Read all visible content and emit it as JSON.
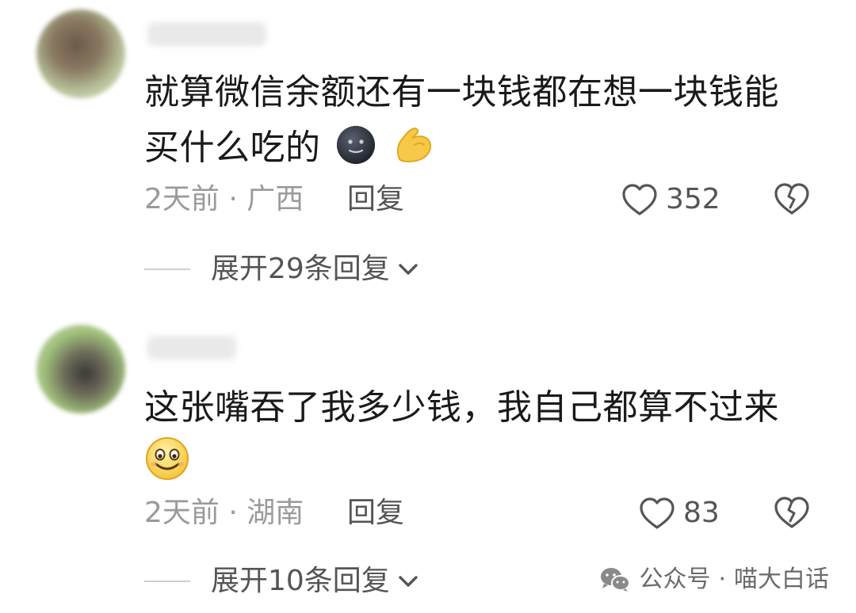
{
  "comments": [
    {
      "text_line1": "就算微信余额还有一块钱都在想一块钱能",
      "text_line2": "买什么吃的",
      "emojis": [
        "new-moon-face-icon",
        "flexed-biceps-icon"
      ],
      "time": "2天前",
      "separator": "·",
      "location": "广西",
      "reply_label": "回复",
      "likes": "352",
      "expand_label": "展开29条回复"
    },
    {
      "text_line1": "这张嘴吞了我多少钱，我自己都算不过来",
      "emojis": [
        "smiling-face-icon"
      ],
      "time": "2天前",
      "separator": "·",
      "location": "湖南",
      "reply_label": "回复",
      "likes": "83",
      "expand_label": "展开10条回复"
    }
  ],
  "watermark": {
    "channel": "公众号",
    "separator": "·",
    "account": "喵大白话"
  },
  "colors": {
    "text": "#1a1a1a",
    "meta": "#9a9a9a",
    "action": "#555555"
  }
}
